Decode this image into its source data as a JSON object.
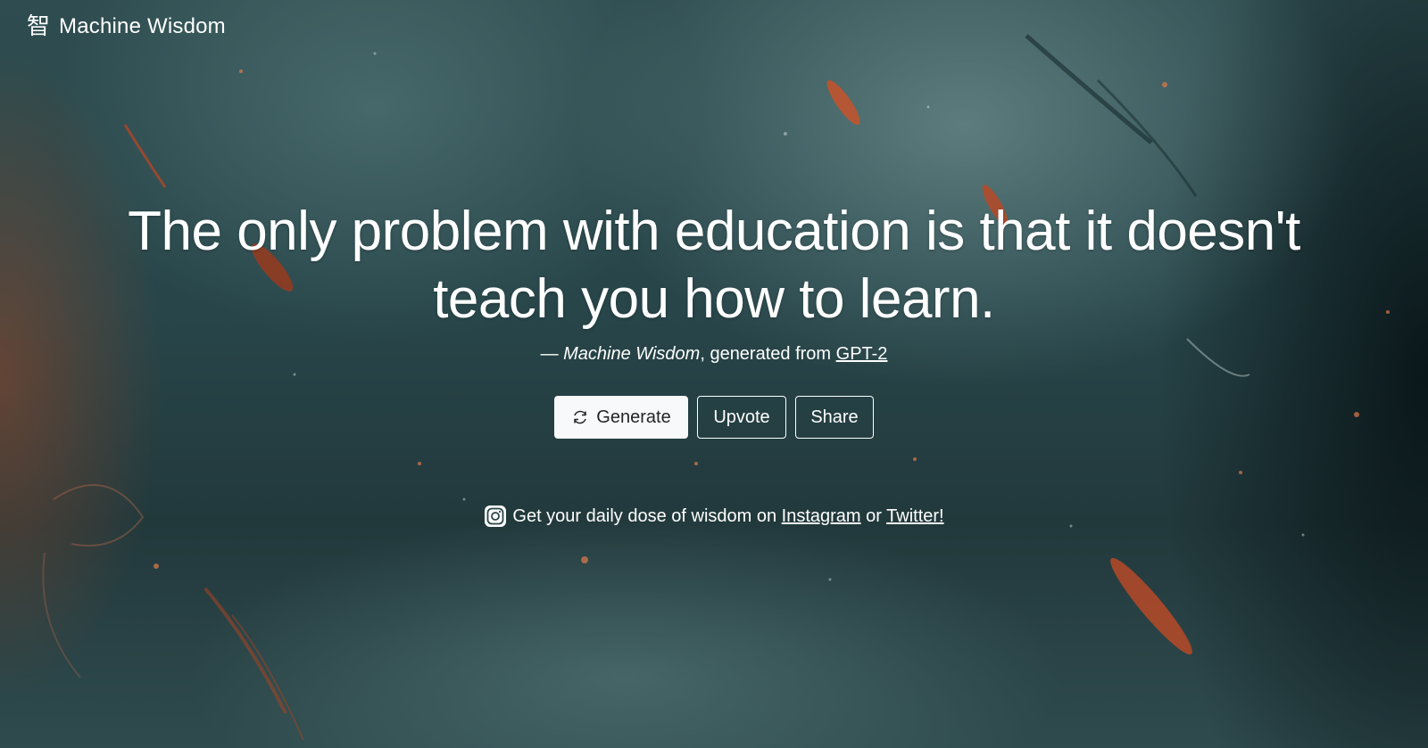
{
  "brand": {
    "glyph": "智",
    "name": "Machine Wisdom"
  },
  "quote": {
    "text": "The only problem with education is that it doesn't teach you how to learn.",
    "attribution_prefix": "— ",
    "attribution_source": "Machine Wisdom",
    "attribution_middle": ", generated from ",
    "attribution_link": "GPT-2"
  },
  "actions": {
    "generate_label": "Generate",
    "upvote_label": "Upvote",
    "share_label": "Share"
  },
  "social": {
    "prefix": "Get your daily dose of wisdom on ",
    "instagram_label": "Instagram",
    "connector": " or ",
    "twitter_label": "Twitter!"
  },
  "icons": {
    "generate": "refresh-icon",
    "social": "instagram-icon"
  },
  "colors": {
    "background": "#2a4548",
    "button_light": "#f8f9fa",
    "text": "#ffffff"
  }
}
